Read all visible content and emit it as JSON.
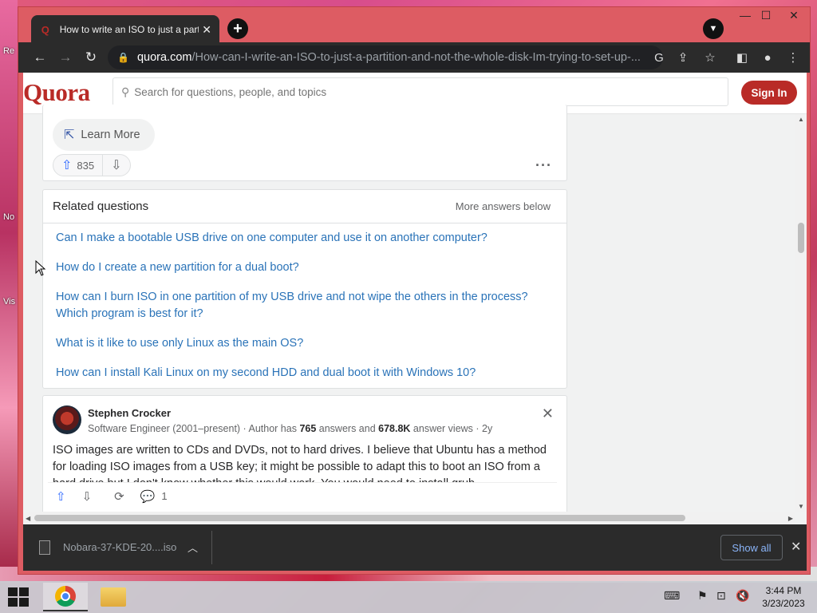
{
  "desktop": {
    "icon_labels": [
      "Re",
      "No",
      "Vis"
    ]
  },
  "browser": {
    "tab": {
      "title": "How to write an ISO to just a partition and not the whole disk",
      "favicon": "Q"
    },
    "new_tab_label": "+",
    "url_domain": "quora.com",
    "url_path": "/How-can-I-write-an-ISO-to-just-a-partition-and-not-the-whole-disk-Im-trying-to-set-up-...",
    "window_controls": {
      "minimize": "—",
      "maximize": "☐",
      "close": "✕"
    }
  },
  "quora": {
    "logo": "Quora",
    "search_placeholder": "Search for questions, people, and topics",
    "signin_label": "Sign In",
    "learn_more_label": "Learn More",
    "upvote_count": "835",
    "related": {
      "title": "Related questions",
      "more_label": "More answers below",
      "items": [
        "Can I make a bootable USB drive on one computer and use it on another computer?",
        "How do I create a new partition for a dual boot?",
        "How can I burn ISO in one partition of my USB drive and not wipe the others in the process? Which program is best for it?",
        "What is it like to use only Linux as the main OS?",
        "How can I install Kali Linux on my second HDD and dual boot it with Windows 10?"
      ]
    },
    "answer": {
      "author": "Stephen Crocker",
      "cred_prefix": "Software Engineer (2001–present) · Author has ",
      "answers_count": "765",
      "cred_mid": " answers and ",
      "views_count": "678.8K",
      "cred_suffix": " answer views · 2y",
      "body": "ISO images are written to CDs and DVDs, not to hard drives. I believe that Ubuntu has a method for loading ISO images from a USB key; it might be possible to adapt this to boot an ISO from a hard drive but I don't know whether this would work. You would need to install grub",
      "comment_count": "1"
    }
  },
  "downloads": {
    "file_name": "Nobara-37-KDE-20....iso",
    "show_all_label": "Show all"
  },
  "taskbar": {
    "time": "3:44 PM",
    "date": "3/23/2023"
  }
}
